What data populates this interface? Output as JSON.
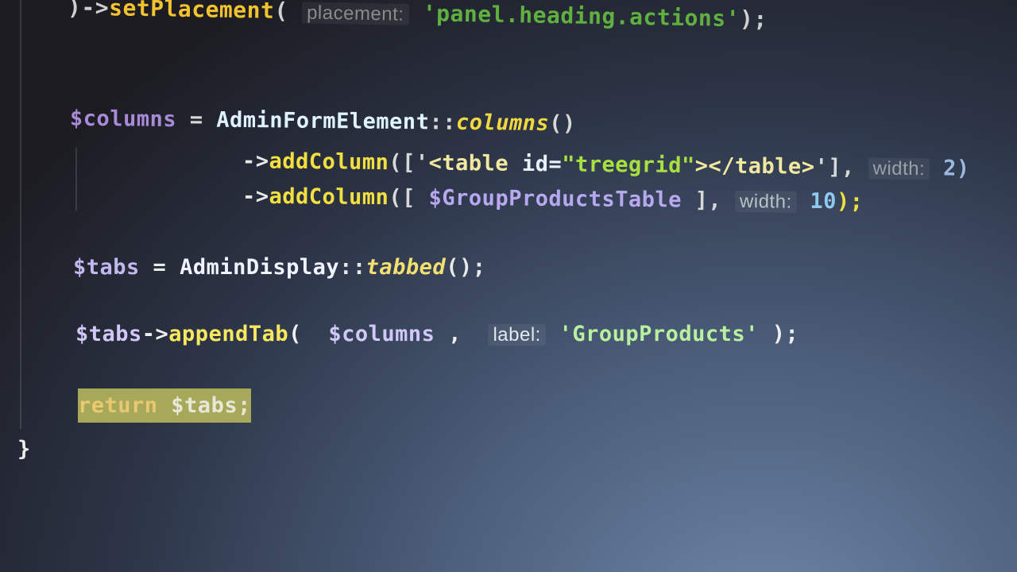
{
  "editor": {
    "lines": [
      {
        "tokens": [
          {
            "text": ")->",
            "color": "#cfcfcf"
          },
          {
            "text": "setPlacement",
            "color": "#f2c230"
          },
          {
            "text": "( ",
            "color": "#cfcfcf"
          },
          {
            "text": "placement:",
            "color": "#8a8a8a",
            "hint": true
          },
          {
            "text": " 'panel.heading.actions'",
            "color": "#5fb040"
          },
          {
            "text": ");",
            "color": "#cfcfcf"
          }
        ]
      },
      {
        "tokens": [
          {
            "text": "$columns",
            "color": "#a88ad8"
          },
          {
            "text": " = ",
            "color": "#d8d8d8"
          },
          {
            "text": "AdminFormElement",
            "color": "#dff2ff"
          },
          {
            "text": "::",
            "color": "#d8d8d8"
          },
          {
            "text": "columns",
            "color": "#f2d840",
            "italic": true
          },
          {
            "text": "()",
            "color": "#d8d8d8"
          }
        ]
      },
      {
        "tokens": [
          {
            "text": "->",
            "color": "#e8e8e8"
          },
          {
            "text": "addColumn",
            "color": "#f2e040"
          },
          {
            "text": "(['",
            "color": "#d8d8d8"
          },
          {
            "text": "<table ",
            "color": "#f2e8a0"
          },
          {
            "text": "id=",
            "color": "#e8f0f8"
          },
          {
            "text": "\"treegrid\"",
            "color": "#a8e040"
          },
          {
            "text": "></table>",
            "color": "#f2e8a0"
          },
          {
            "text": "'], ",
            "color": "#d8d8d8"
          },
          {
            "text": "width:",
            "color": "#9aa0a8",
            "hint": true
          },
          {
            "text": " 2)",
            "color": "#9ab8e0"
          }
        ]
      },
      {
        "tokens": [
          {
            "text": "->",
            "color": "#e8e8e8"
          },
          {
            "text": "addColumn",
            "color": "#f2e040"
          },
          {
            "text": "([ ",
            "color": "#d8d8d8"
          },
          {
            "text": "$GroupProductsTable",
            "color": "#b8a8f0"
          },
          {
            "text": " ], ",
            "color": "#d8d8d8"
          },
          {
            "text": "width:",
            "color": "#b8c0c8",
            "hint": true
          },
          {
            "text": " 10",
            "color": "#90c8f0"
          },
          {
            "text": ");",
            "color": "#f2e040"
          }
        ]
      },
      {
        "tokens": [
          {
            "text": "$tabs",
            "color": "#c0b8f0"
          },
          {
            "text": " = ",
            "color": "#e8e8e8"
          },
          {
            "text": "AdminDisplay",
            "color": "#f0f4ff"
          },
          {
            "text": "::",
            "color": "#e8e8e8"
          },
          {
            "text": "tabbed",
            "color": "#f2e070",
            "italic": true
          },
          {
            "text": "();",
            "color": "#e8e8e8"
          }
        ]
      },
      {
        "tokens": [
          {
            "text": "$tabs",
            "color": "#d0c8f8"
          },
          {
            "text": "->",
            "color": "#f0f0f0"
          },
          {
            "text": "appendTab",
            "color": "#f8e860"
          },
          {
            "text": "(  ",
            "color": "#f0f0f0"
          },
          {
            "text": "$columns",
            "color": "#d0c8f8"
          },
          {
            "text": " ,  ",
            "color": "#f0f0f0"
          },
          {
            "text": "label:",
            "color": "#e0e8f0",
            "hint": true
          },
          {
            "text": " 'GroupProducts'",
            "color": "#b8f0a0"
          },
          {
            "text": " );",
            "color": "#f0f0f0"
          }
        ]
      },
      {
        "tokens": [
          {
            "text": "return ",
            "color": "#e8c870",
            "highlight": true
          },
          {
            "text": "$tabs;",
            "color": "#e8e8d8",
            "highlight": true
          }
        ]
      },
      {
        "tokens": [
          {
            "text": "}",
            "color": "#f0f0f0"
          }
        ]
      }
    ]
  }
}
